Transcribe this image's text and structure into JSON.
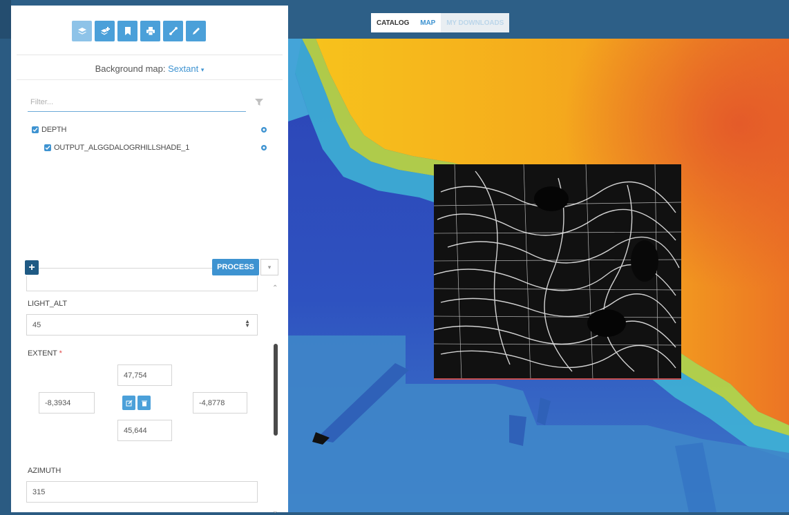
{
  "tabs": [
    {
      "label": "CATALOG"
    },
    {
      "label": "MAP"
    },
    {
      "label": "MY DOWNLOADS"
    }
  ],
  "toolbar": {
    "icons": [
      "layers-icon",
      "add-layer-icon",
      "bookmark-icon",
      "print-icon",
      "measure-icon",
      "draw-icon"
    ]
  },
  "background_map": {
    "label": "Background map:",
    "value": "Sextant",
    "caret": "▾"
  },
  "filter": {
    "placeholder": "Filter..."
  },
  "layers": [
    {
      "label": "DEPTH",
      "checked": true
    },
    {
      "label": "OUTPUT_ALGGDALOGRHILLSHADE_1",
      "checked": true
    }
  ],
  "process": {
    "add_label": "+",
    "button_label": "PROCESS",
    "caret": "▾"
  },
  "form": {
    "light_alt": {
      "label": "LIGHT_ALT",
      "value": "45"
    },
    "extent": {
      "label": "EXTENT",
      "required_mark": "*",
      "north": "47,754",
      "west": "-8,3934",
      "east": "-4,8778",
      "south": "45,644"
    },
    "azimuth": {
      "label": "AZIMUTH",
      "value": "315"
    }
  },
  "colors": {
    "accent": "#3e93d1",
    "topbar": "#2d5f87",
    "dark_button": "#1f5a84"
  }
}
